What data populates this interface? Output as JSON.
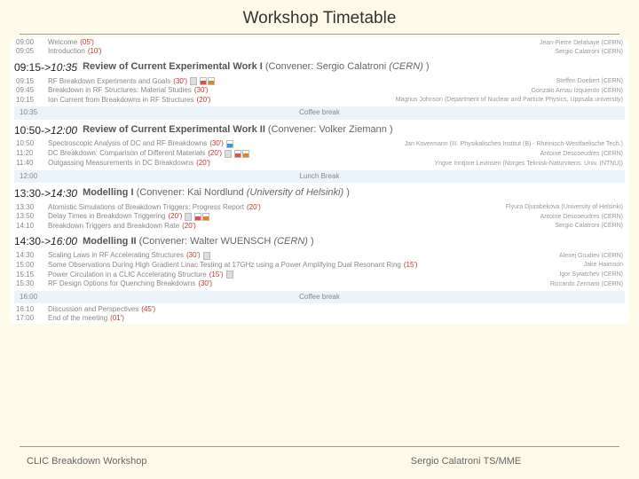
{
  "header": {
    "title": "Workshop Timetable"
  },
  "intro": [
    {
      "time": "09:00",
      "name": "Welcome",
      "dur": "(05')",
      "auth": "Jean-Pierre Delahaye (CERN)"
    },
    {
      "time": "09:05",
      "name": "Introduction",
      "dur": "(10')",
      "auth": "Sergio Calatroni (CERN)"
    }
  ],
  "sessions": [
    {
      "start": "09:15",
      "end": "10:35",
      "title": "Review of Current Experimental Work I",
      "convener": "Sergio Calatroni",
      "affil": "CERN",
      "items": [
        {
          "time": "09:15",
          "name": "RF Breakdown Experiments and Goals",
          "dur": "(30')",
          "auth": "Steffen Doebert (CERN)"
        },
        {
          "time": "09:45",
          "name": "Breakdown in RF Structures: Material Studies",
          "dur": "(30')",
          "auth": "Gonzalo Arnau Izquierdo (CERN)"
        },
        {
          "time": "10:15",
          "name": "Ion Current from Breakdowns in RF Structures",
          "dur": "(20')",
          "auth": "Magnus Johnson (Department of Nuclear and Particle Physics, Uppsala university)"
        }
      ],
      "break": {
        "time": "10:35",
        "name": "Coffee break"
      }
    },
    {
      "start": "10:50",
      "end": "12:00",
      "title": "Review of Current Experimental Work II",
      "convener": "Volker Ziemann",
      "items": [
        {
          "time": "10:50",
          "name": "Spectroscopic Analysis of DC and RF Breakdowns",
          "dur": "(30')",
          "auth": "Jan Kovermann (III. Physikalisches Institut (B) - Rheinisch-Westfaelische Tech.)"
        },
        {
          "time": "11:20",
          "name": "DC Breakdown: Comparison of Different Materials",
          "dur": "(20')",
          "auth": "Antoine Descoeudres (CERN)"
        },
        {
          "time": "11:40",
          "name": "Outgassing Measurements in DC Breakdowns",
          "dur": "(20')",
          "auth": "Yngve Inntjore Levinsen (Norges Teknisk-Naturvitens. Univ. (NTNU))"
        }
      ],
      "break": {
        "time": "12:00",
        "name": "Lunch Break"
      }
    },
    {
      "start": "13:30",
      "end": "14:30",
      "title": "Modelling I",
      "convener": "Kai Nordlund",
      "affil": "University of Helsinki",
      "items": [
        {
          "time": "13:30",
          "name": "Atomistic Simulations of Breakdown Triggers: Progress Report",
          "dur": "(20')",
          "auth": "Flyura Djurabekova (University of Helsinki)"
        },
        {
          "time": "13:50",
          "name": "Delay Times in Breakdown Triggering",
          "dur": "(20')",
          "auth": "Antoine Descoeudres (CERN)"
        },
        {
          "time": "14:10",
          "name": "Breakdown Triggers and Breakdown Rate",
          "dur": "(20')",
          "auth": "Sergio Calatroni (CERN)"
        }
      ]
    },
    {
      "start": "14:30",
      "end": "16:00",
      "title": "Modelling II",
      "convener": "Walter WUENSCH",
      "affil": "CERN",
      "items": [
        {
          "time": "14:30",
          "name": "Scaling Laws in RF Accelerating Structures",
          "dur": "(30')",
          "auth": "Alexej Grudiev (CERN)"
        },
        {
          "time": "15:00",
          "name": "Some Observations During High Gradient Linac Testing at 17GHz using a Power Amplifying Dual Resonant Ring",
          "dur": "(15')",
          "auth": "Jake Haimson"
        },
        {
          "time": "15:15",
          "name": "Power Circulation in a CLIC Accelerating Structure",
          "dur": "(15')",
          "auth": "Igor Syratchev (CERN)"
        },
        {
          "time": "15:30",
          "name": "RF Design Options for Quenching Breakdowns",
          "dur": "(30')",
          "auth": "Riccardo Zennaro (CERN)"
        }
      ],
      "break": {
        "time": "16:00",
        "name": "Coffee break"
      }
    }
  ],
  "closing": [
    {
      "time": "16:10",
      "name": "Discussion and Perspectives",
      "dur": "(45')"
    },
    {
      "time": "17:00",
      "name": "End of the meeting",
      "dur": "(01')"
    }
  ],
  "footer": {
    "left": "CLIC Breakdown Workshop",
    "center": "Sergio Calatroni TS/MME"
  }
}
